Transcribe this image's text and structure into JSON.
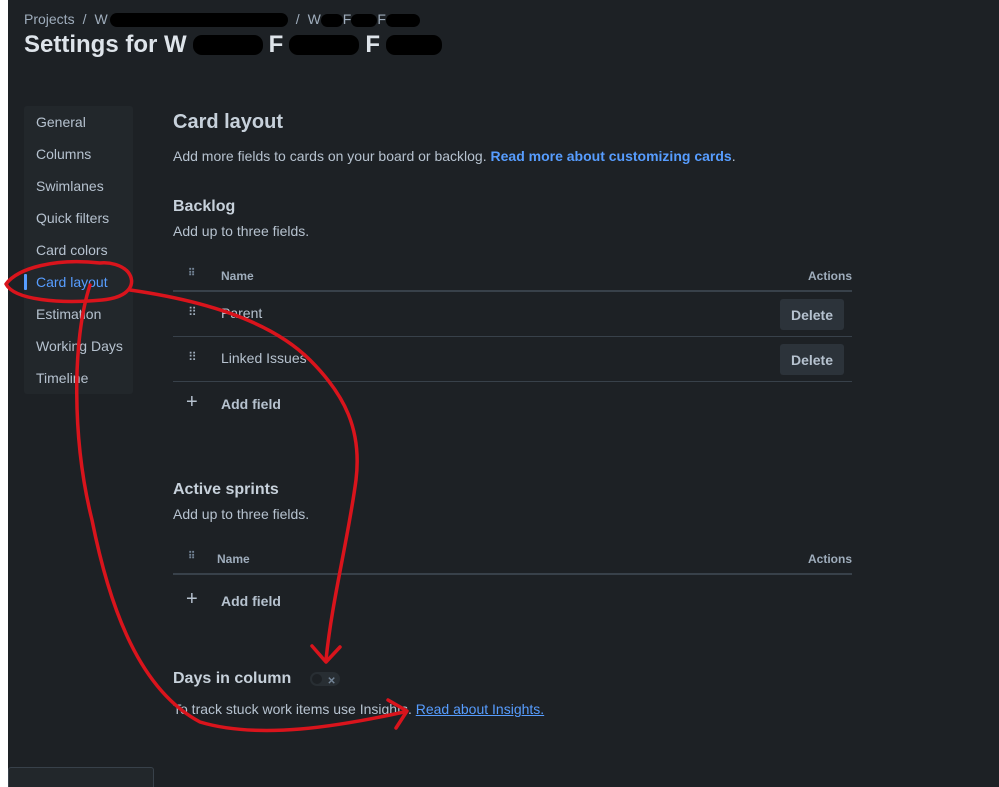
{
  "breadcrumb": {
    "root": "Projects",
    "separator": "/",
    "project_prefix": "W",
    "board_prefix": "W",
    "board_mid": "F",
    "board_end": "F"
  },
  "title": {
    "prefix": "Settings for W",
    "mid": "F",
    "end": "F"
  },
  "sidebar": {
    "items": [
      {
        "label": "General"
      },
      {
        "label": "Columns"
      },
      {
        "label": "Swimlanes"
      },
      {
        "label": "Quick filters"
      },
      {
        "label": "Card colors"
      },
      {
        "label": "Card layout"
      },
      {
        "label": "Estimation"
      },
      {
        "label": "Working Days"
      },
      {
        "label": "Timeline"
      }
    ],
    "active_index": 5
  },
  "main": {
    "heading": "Card layout",
    "description": "Add more fields to cards on your board or backlog. ",
    "description_link": "Read more about customizing cards",
    "description_end": ".",
    "backlog": {
      "title": "Backlog",
      "subtitle": "Add up to three fields.",
      "col_name": "Name",
      "col_actions": "Actions",
      "rows": [
        {
          "name": "Parent",
          "action": "Delete"
        },
        {
          "name": "Linked Issues",
          "action": "Delete"
        }
      ],
      "add_label": "Add field"
    },
    "active_sprints": {
      "title": "Active sprints",
      "subtitle": "Add up to three fields.",
      "col_name": "Name",
      "col_actions": "Actions",
      "add_label": "Add field"
    },
    "days_in_column": {
      "title": "Days in column",
      "toggle_on": false,
      "text": "To track stuck work items use Insights. ",
      "link": "Read about Insights."
    }
  },
  "colors": {
    "background": "#1d2125",
    "accent": "#579dff",
    "annotation": "#d9141c"
  },
  "icons": {
    "drag_handle": "⠿",
    "plus": "+",
    "toggle_x": "✕"
  }
}
